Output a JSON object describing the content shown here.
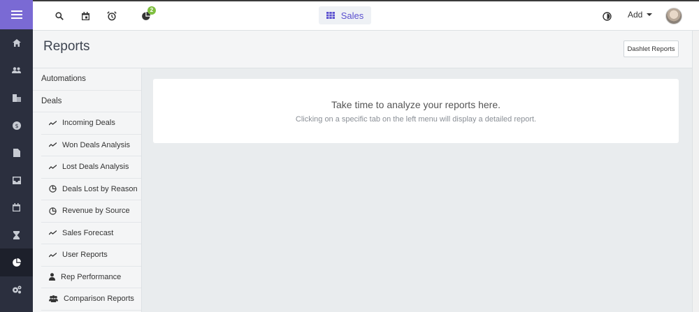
{
  "topbar": {
    "notification_badge": "2",
    "app_switcher_label": "Sales",
    "add_label": "Add"
  },
  "page": {
    "title": "Reports",
    "dashlet_button": "Dashlet Reports"
  },
  "menu": {
    "automations": "Automations",
    "deals": "Deals",
    "items": [
      {
        "label": "Incoming Deals",
        "icon": "trend-line-icon"
      },
      {
        "label": "Won Deals Analysis",
        "icon": "trend-line-icon"
      },
      {
        "label": "Lost Deals Analysis",
        "icon": "trend-line-icon"
      },
      {
        "label": "Deals Lost by Reason",
        "icon": "pie-chart-icon"
      },
      {
        "label": "Revenue by Source",
        "icon": "pie-chart-icon"
      },
      {
        "label": "Sales Forecast",
        "icon": "trend-line-icon"
      },
      {
        "label": "User Reports",
        "icon": "trend-line-icon"
      },
      {
        "label": "Rep Performance",
        "icon": "user-icon"
      },
      {
        "label": "Comparison Reports",
        "icon": "users-icon"
      }
    ]
  },
  "content": {
    "title": "Take time to analyze your reports here.",
    "subtitle": "Clicking on a specific tab on the left menu will display a detailed report."
  },
  "colors": {
    "rail": "#2b2f3e",
    "rail_accent": "#7a6ad4",
    "app_accent": "#5a4fcf",
    "badge": "#7fbf3f"
  }
}
